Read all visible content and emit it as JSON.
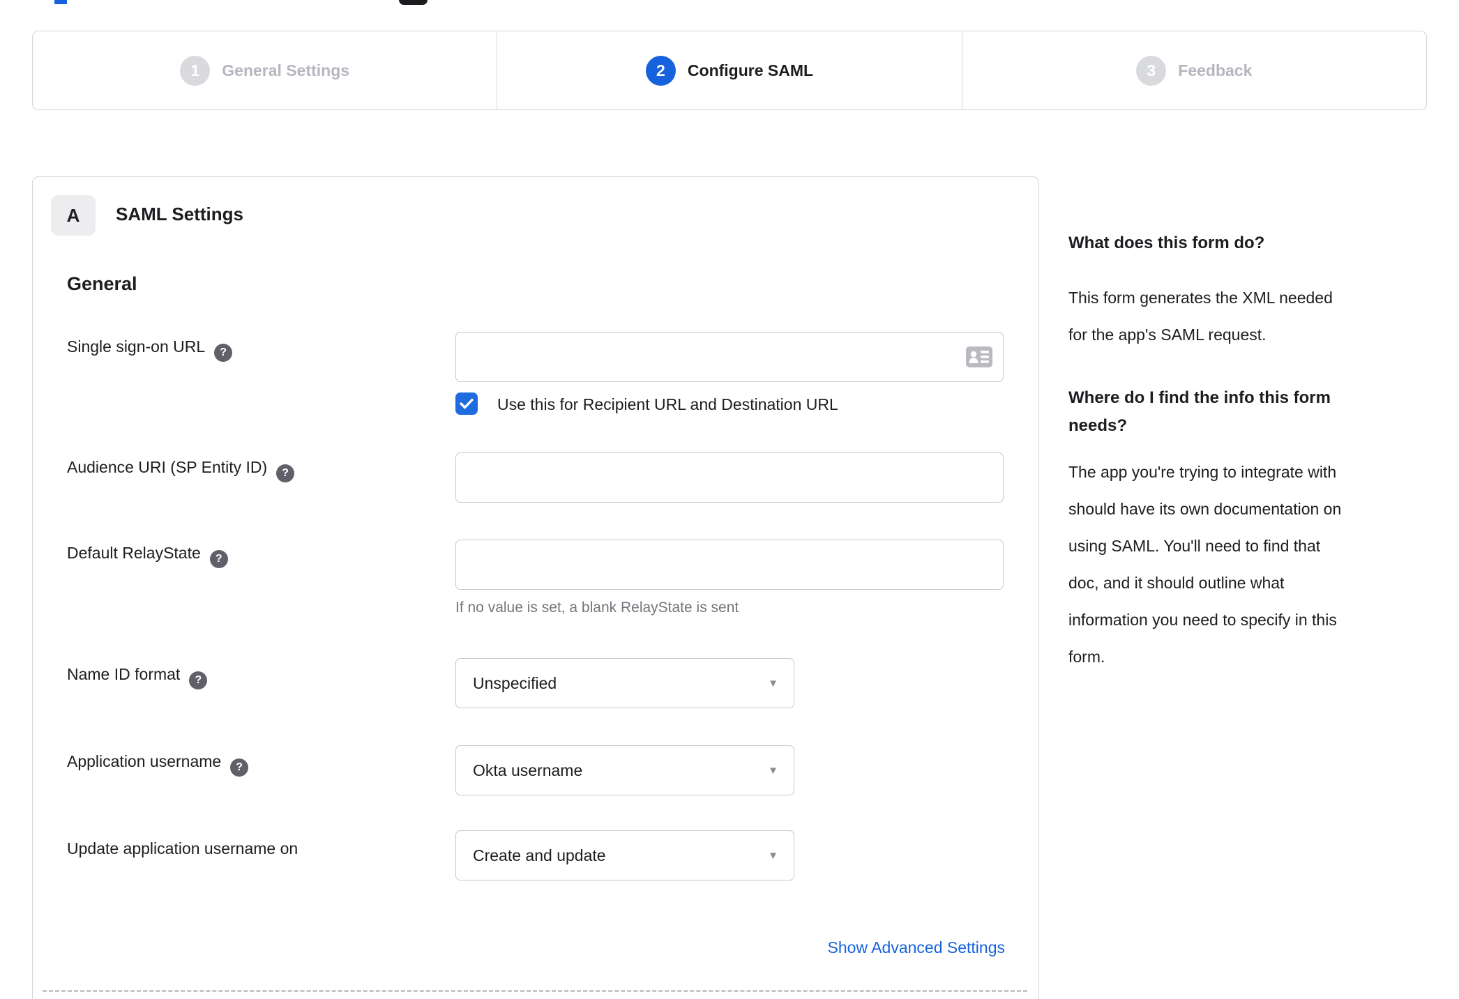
{
  "colors": {
    "accent_blue": "#1662dd",
    "checkbox_blue": "#1f6be0",
    "inactive_gray": "#b5b6be",
    "border_gray": "#d6d6da",
    "text_dark": "#1d1d21"
  },
  "stepper": {
    "steps": [
      {
        "number": "1",
        "label": "General Settings",
        "state": "inactive"
      },
      {
        "number": "2",
        "label": "Configure SAML",
        "state": "active"
      },
      {
        "number": "3",
        "label": "Feedback",
        "state": "inactive"
      }
    ]
  },
  "panel": {
    "badge": "A",
    "title": "SAML Settings",
    "section_title": "General",
    "fields": [
      {
        "label": "Single sign-on URL",
        "value": "",
        "checkbox": {
          "checked": true,
          "label": "Use this for Recipient URL and Destination URL"
        }
      },
      {
        "label": "Audience URI (SP Entity ID)",
        "value": ""
      },
      {
        "label": "Default RelayState",
        "value": "",
        "hint": "If no value is set, a blank RelayState is sent"
      },
      {
        "label": "Name ID format",
        "value": "Unspecified"
      },
      {
        "label": "Application username",
        "value": "Okta username"
      },
      {
        "label": "Update application username on",
        "value": "Create and update"
      }
    ],
    "advanced_link": "Show Advanced Settings"
  },
  "sidebar": {
    "heading1": "What does this form do?",
    "paragraph1": "This form generates the XML needed\nfor the app's SAML request.",
    "heading2": "Where do I find the info this form\nneeds?",
    "paragraph2": "The app you're trying to integrate with\nshould have its own documentation on\nusing SAML. You'll need to find that\ndoc, and it should outline what\ninformation you need to specify in this\nform."
  }
}
